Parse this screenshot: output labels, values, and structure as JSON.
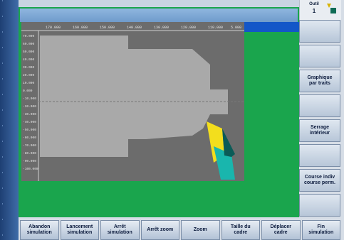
{
  "tool": {
    "label": "Outil",
    "number": "1"
  },
  "plot": {
    "x_ticks": [
      "170.000",
      "160.000",
      "150.000",
      "140.000",
      "130.000",
      "120.000",
      "110.000",
      "5.000"
    ],
    "y_ticks": [
      "70.000",
      "60.000",
      "50.000",
      "40.000",
      "30.000",
      "20.000",
      "10.000",
      "0.000",
      "-10.000",
      "-20.000",
      "-30.000",
      "-40.000",
      "-50.000",
      "-60.000",
      "-70.000",
      "-80.000",
      "-90.000",
      "-100.000"
    ]
  },
  "colors": {
    "screen_bg": "#1aa54d",
    "plot_bg": "#6c6c6c",
    "workpiece": "#a9a9a9",
    "tool_yellow": "#f3de1d",
    "tool_cyan": "#19b6ad",
    "softkey_bg": "#c9d5e3"
  },
  "vertical_softkeys": [
    "",
    "",
    "Graphique\npar traits",
    "",
    "Serrage\nintérieur",
    "",
    "Course indiv\ncourse perm.",
    ""
  ],
  "horizontal_softkeys": [
    "Abandon\nsimulation",
    "Lancement\nsimulation",
    "Arrêt\nsimulation",
    "Arrêt zoom",
    "Zoom",
    "Taille du\ncadre",
    "Déplacer\ncadre",
    "Fin\nsimulation"
  ]
}
